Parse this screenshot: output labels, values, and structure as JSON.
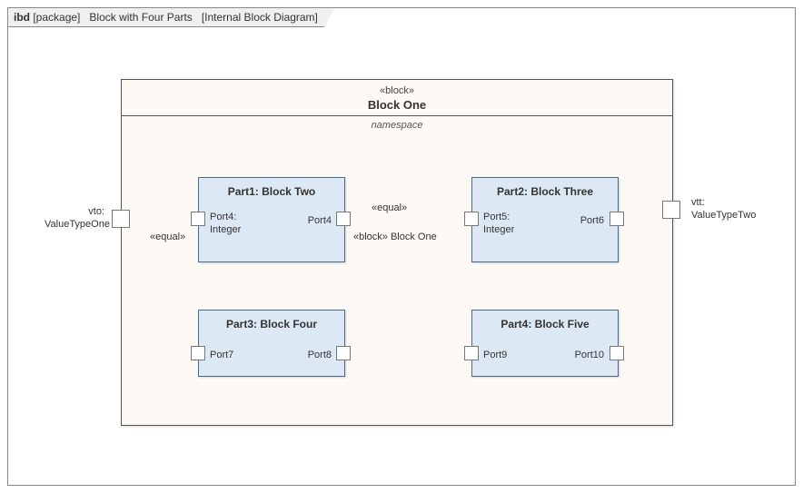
{
  "frame": {
    "kind": "ibd",
    "kind_suffix": "[package]",
    "title": "Block with Four Parts",
    "subtitle": "[Internal Block Diagram]"
  },
  "blockOne": {
    "stereotype": "«block»",
    "name": "Block One",
    "namespace": "namespace"
  },
  "parts": {
    "p1": {
      "title": "Part1: Block Two",
      "left": "Port4:\nInteger",
      "right": "Port4"
    },
    "p2": {
      "title": "Part2: Block Three",
      "left": "Port5:\nInteger",
      "right": "Port6"
    },
    "p3": {
      "title": "Part3: Block Four",
      "left": "Port7",
      "right": "Port8"
    },
    "p4": {
      "title": "Part4: Block Five",
      "left": "Port9",
      "right": "Port10"
    }
  },
  "outerPorts": {
    "left": {
      "name": "vto:",
      "type": "ValueTypeOne"
    },
    "right": {
      "name": "vtt:",
      "type": "ValueTypeTwo"
    }
  },
  "connectors": {
    "leftEqual": "«equal»",
    "midEqual": "«equal»",
    "midType": "«block» Block One"
  }
}
